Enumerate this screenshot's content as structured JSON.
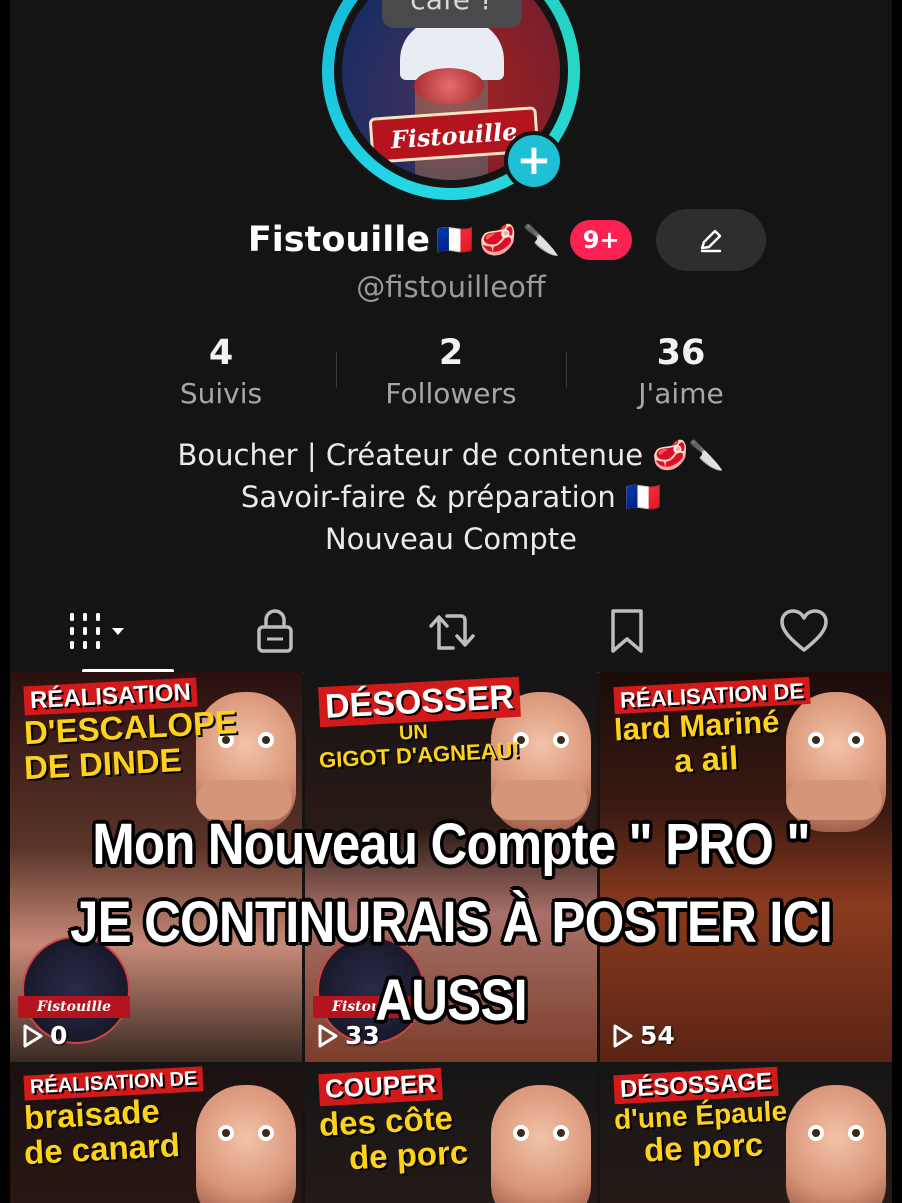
{
  "profile": {
    "story_badge": "café ?",
    "avatar_logo_text": "Fistouille",
    "display_name": "Fistouille",
    "name_emojis": [
      "🇫🇷",
      "🥩",
      "🔪"
    ],
    "notifications_badge": "9+",
    "handle": "@fistouilleoff"
  },
  "stats": [
    {
      "value": "4",
      "label": "Suivis"
    },
    {
      "value": "2",
      "label": "Followers"
    },
    {
      "value": "36",
      "label": "J'aime"
    }
  ],
  "bio": {
    "line1": "Boucher | Créateur de contenue 🥩🔪",
    "line2": "Savoir-faire & préparation 🇫🇷",
    "line3": "Nouveau Compte"
  },
  "tabs": [
    {
      "icon": "videos-grid-icon",
      "active": true
    },
    {
      "icon": "lock-icon",
      "active": false
    },
    {
      "icon": "repost-icon",
      "active": false
    },
    {
      "icon": "bookmark-icon",
      "active": false
    },
    {
      "icon": "heart-icon",
      "active": false
    }
  ],
  "videos": [
    {
      "title_red": "RÉALISATION",
      "title_yellow": "D'ESCALOPE",
      "title_white": "DE DINDE",
      "logo_text": "Fistouille",
      "views": "0"
    },
    {
      "title_red": "DÉSOSSER",
      "title_yellow": "UN",
      "title_white": "GIGOT D'AGNEAU!",
      "logo_text": "Fistouille",
      "views": "33"
    },
    {
      "title_red": "RÉALISATION DE",
      "title_yellow": "lard Mariné",
      "title_white": "a ail",
      "views": "54"
    },
    {
      "title_red": "RÉALISATION DE",
      "title_yellow": "braisade",
      "title_white": "de canard"
    },
    {
      "title_red": "COUPER",
      "title_yellow": "des côte",
      "title_white": "de porc"
    },
    {
      "title_red": "DÉSOSSAGE",
      "title_yellow": "d'une Épaule",
      "title_white": "de porc"
    }
  ],
  "overlay": {
    "line1": "Mon Nouveau Compte \" PRO \"",
    "line2": "JE CONTINURAIS À POSTER ICI AUSSI"
  },
  "colors": {
    "background": "#141414",
    "ring": "#24d6e6",
    "badge": "#fb2253",
    "follow_plus": "#1fbfd6"
  }
}
